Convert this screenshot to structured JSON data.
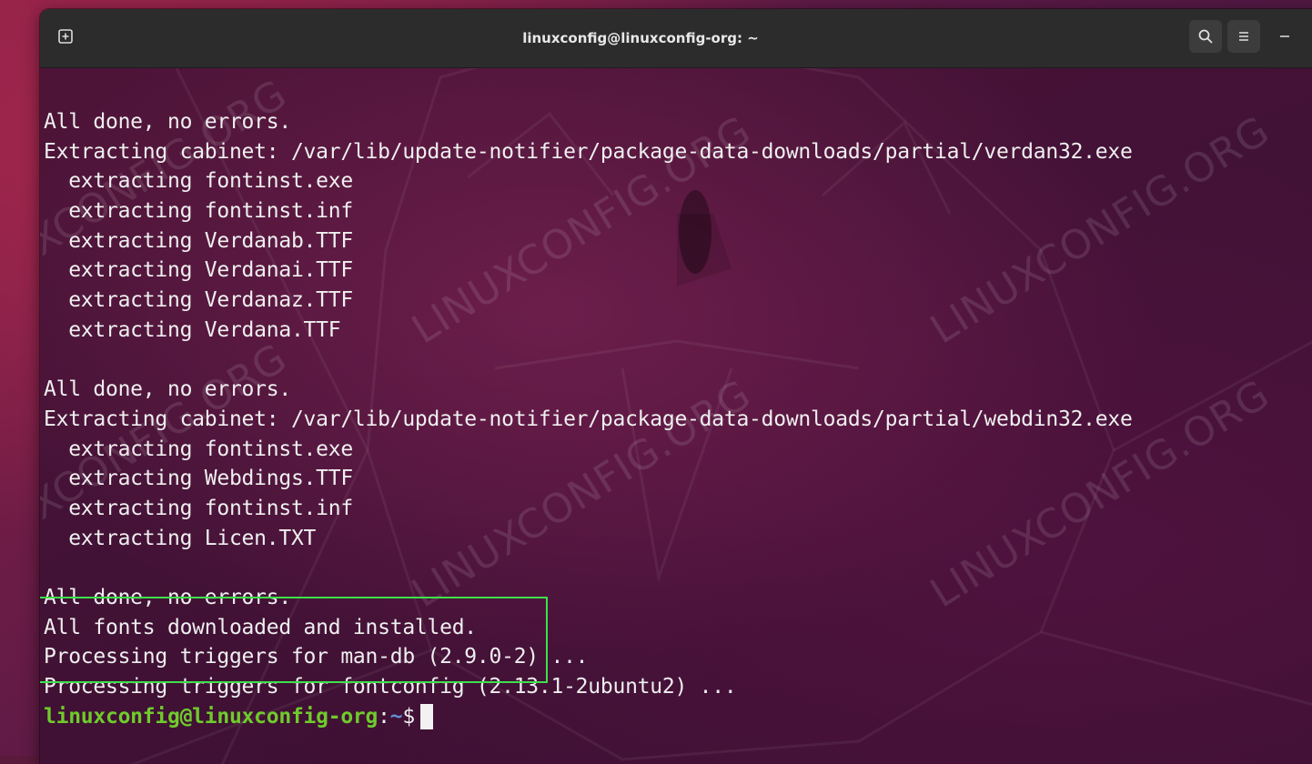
{
  "window": {
    "title": "linuxconfig@linuxconfig-org: ~"
  },
  "terminal": {
    "lines": [
      "All done, no errors.",
      "Extracting cabinet: /var/lib/update-notifier/package-data-downloads/partial/verdan32.exe",
      "  extracting fontinst.exe",
      "  extracting fontinst.inf",
      "  extracting Verdanab.TTF",
      "  extracting Verdanai.TTF",
      "  extracting Verdanaz.TTF",
      "  extracting Verdana.TTF",
      "",
      "All done, no errors.",
      "Extracting cabinet: /var/lib/update-notifier/package-data-downloads/partial/webdin32.exe",
      "  extracting fontinst.exe",
      "  extracting Webdings.TTF",
      "  extracting fontinst.inf",
      "  extracting Licen.TXT",
      "",
      "All done, no errors.",
      "All fonts downloaded and installed.",
      "Processing triggers for man-db (2.9.0-2) ...",
      "Processing triggers for fontconfig (2.13.1-2ubuntu2) ..."
    ],
    "prompt": {
      "user_host": "linuxconfig@linuxconfig-org",
      "separator": ":",
      "path": "~",
      "symbol": "$"
    }
  },
  "watermark": {
    "text": "LINUXCONFIG.ORG"
  },
  "colors": {
    "prompt_user": "#6fcb2c",
    "prompt_path": "#5f8fd4",
    "highlight_box": "#3ee04a",
    "titlebar": "#2c2c2c"
  }
}
